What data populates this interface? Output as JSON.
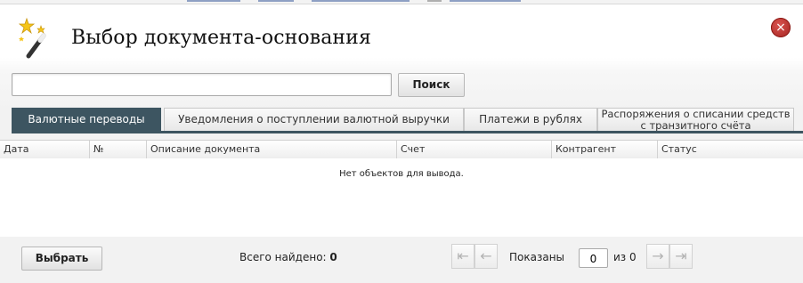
{
  "dialog": {
    "title": "Выбор документа-основания",
    "close_icon": "×",
    "wand_icon": "magic-wand-icon"
  },
  "search": {
    "value": "",
    "placeholder": "",
    "button_label": "Поиск"
  },
  "tabs": [
    {
      "label": "Валютные переводы",
      "active": true
    },
    {
      "label": "Уведомления о поступлении валютной выручки",
      "active": false
    },
    {
      "label": "Платежи в рублях",
      "active": false
    },
    {
      "label": "Распоряжения о списании средств с транзитного счёта",
      "active": false
    }
  ],
  "colors": {
    "active_tab": "#3d5561",
    "close_button": "#b9302b"
  },
  "table": {
    "columns": [
      "Дата",
      "№",
      "Описание документа",
      "Счет",
      "Контрагент",
      "Статус"
    ],
    "rows": [],
    "empty_message": "Нет объектов для вывода."
  },
  "footer": {
    "select_button_label": "Выбрать",
    "total_label": "Всего найдено:",
    "total_value": "0",
    "shown_label": "Показаны",
    "page_value": "0",
    "of_label": "из 0",
    "first_icon": "⇤",
    "prev_icon": "←",
    "next_icon": "→",
    "last_icon": "⇥"
  }
}
